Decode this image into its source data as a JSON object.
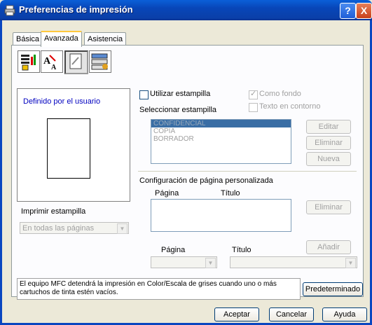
{
  "window": {
    "title": "Preferencias de impresión",
    "help": "?",
    "close": "X"
  },
  "tabs": [
    "Básica",
    "Avanzada",
    "Asistencia"
  ],
  "preview": {
    "label": "Definido por el usuario"
  },
  "stamp": {
    "use_label": "Utilizar estampilla",
    "select_label": "Seleccionar estampilla",
    "as_background": "Como fondo",
    "outline_text": "Texto en contorno",
    "items": [
      "CONFIDENCIAL",
      "COPIA",
      "BORRADOR"
    ],
    "edit": "Editar",
    "delete": "Eliminar",
    "new": "Nueva",
    "print_label": "Imprimir estampilla",
    "print_value": "En todas las páginas"
  },
  "custom_page": {
    "title": "Configuración de página personalizada",
    "col_page": "Página",
    "col_title": "Título",
    "delete": "Eliminar",
    "add": "Añadir",
    "page_label": "Página",
    "title_label": "Título"
  },
  "info_text": "El equipo MFC detendrá la impresión en Color/Escala de grises cuando uno o más cartuchos de tinta estén vacíos.",
  "buttons": {
    "default": "Predeterminado",
    "ok": "Aceptar",
    "cancel": "Cancelar",
    "help": "Ayuda"
  }
}
